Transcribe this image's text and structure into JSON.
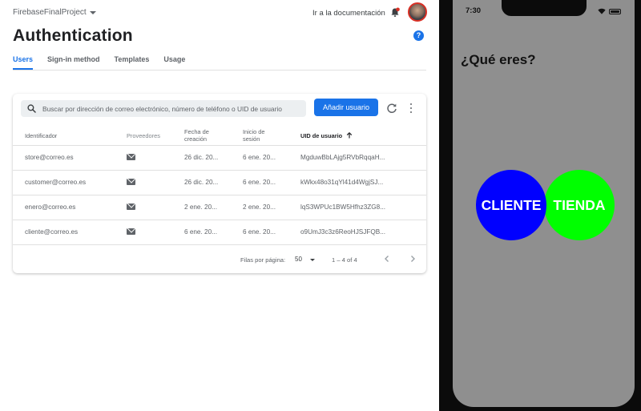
{
  "console": {
    "project_name": "FirebaseFinalProject",
    "docs_link": "Ir a la documentación",
    "page_title": "Authentication",
    "help_symbol": "?",
    "tabs": [
      {
        "label": "Users",
        "active": true
      },
      {
        "label": "Sign-in method",
        "active": false
      },
      {
        "label": "Templates",
        "active": false
      },
      {
        "label": "Usage",
        "active": false
      }
    ],
    "search": {
      "placeholder": "Buscar por dirección de correo electrónico, número de teléfono o UID de usuario"
    },
    "add_button": "Añadir usuario",
    "table": {
      "columns": [
        "Identificador",
        "Proveedores",
        "Fecha de creación",
        "Inicio de sesión",
        "UID de usuario"
      ],
      "rows": [
        {
          "identifier": "store@correo.es",
          "provider": "mail-icon",
          "created": "26 dic. 20...",
          "signed_in": "6 ene. 20...",
          "uid": "MgduwBbLAjg5RVbRqqaH..."
        },
        {
          "identifier": "customer@correo.es",
          "provider": "mail-icon",
          "created": "26 dic. 20...",
          "signed_in": "6 ene. 20...",
          "uid": "kWkx48o31qYl41d4WgjSJ..."
        },
        {
          "identifier": "enero@correo.es",
          "provider": "mail-icon",
          "created": "2 ene. 20...",
          "signed_in": "2 ene. 20...",
          "uid": "lqS3WPUc1BW5Hfhz3ZG8..."
        },
        {
          "identifier": "cliente@correo.es",
          "provider": "mail-icon",
          "created": "6 ene. 20...",
          "signed_in": "6 ene. 20...",
          "uid": "o9UmJ3c3z6ReoHJSJFQB..."
        }
      ]
    },
    "pagination": {
      "rows_per_page_label": "Filas por página:",
      "rows_per_page": "50",
      "range": "1 – 4 of 4"
    },
    "colors": {
      "accent": "#1a73e8",
      "notification_badge": "#d93025"
    }
  },
  "phone": {
    "time": "7:30",
    "question": "¿Qué eres?",
    "options": [
      {
        "label": "CLIENTE",
        "color": "#0000ff"
      },
      {
        "label": "TIENDA",
        "color": "#00ff00"
      }
    ]
  }
}
